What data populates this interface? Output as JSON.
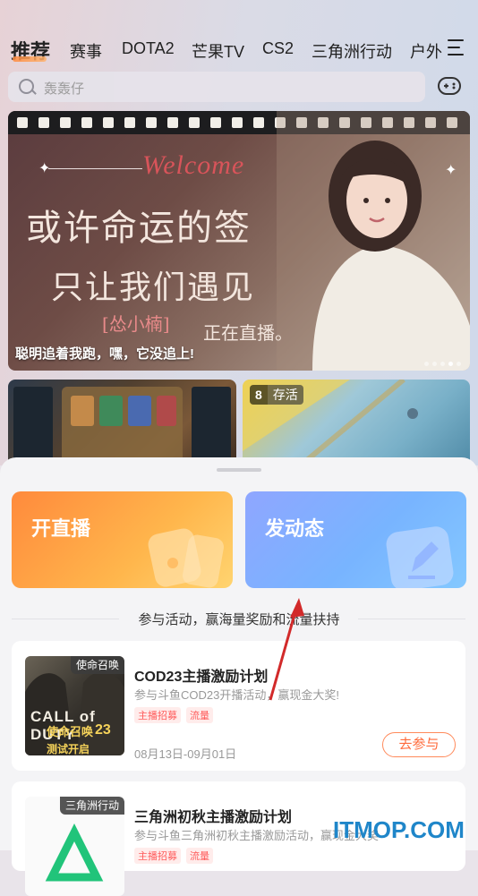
{
  "tabs": [
    "推荐",
    "赛事",
    "DOTA2",
    "芒果TV",
    "CS2",
    "三角洲行动",
    "户外"
  ],
  "search": {
    "placeholder": "轰轰仔"
  },
  "banner": {
    "welcome": "Welcome",
    "line1": "或许命运的签",
    "line2": "只让我们遇见",
    "streamer": "[怂小楠]",
    "live": "正在直播。",
    "caption": "聪明追着我跑，嘿，它没追上!",
    "dots_total": 5,
    "dots_active": 4
  },
  "thumbs": {
    "right_count": "8",
    "right_label": "存活"
  },
  "sheet": {
    "card_live": "开直播",
    "card_post": "发动态",
    "section_title": "参与活动，赢海量奖励和流量扶持",
    "events": [
      {
        "tag": "使命召唤",
        "poster_logo": "CALL of DUTY",
        "poster_cn": "使命召唤",
        "poster_num": "23",
        "poster_sub": "测试开启",
        "title": "COD23主播激励计划",
        "desc": "参与斗鱼COD23开播活动，赢现金大奖!",
        "tags": [
          "主播招募",
          "流量"
        ],
        "date": "08月13日-09月01日",
        "button": "去参与"
      },
      {
        "tag": "三角洲行动",
        "title": "三角洲初秋主播激励计划",
        "desc": "参与斗鱼三角洲初秋主播激励活动，赢现金大奖",
        "tags": [
          "主播招募",
          "流量"
        ]
      }
    ]
  },
  "watermark": "ITMOP.COM",
  "colors": {
    "accent": "#ff6a3a",
    "live_card": "#ff9a40",
    "post_card": "#7fb0ff",
    "tag_red": "#ff5a5a"
  }
}
